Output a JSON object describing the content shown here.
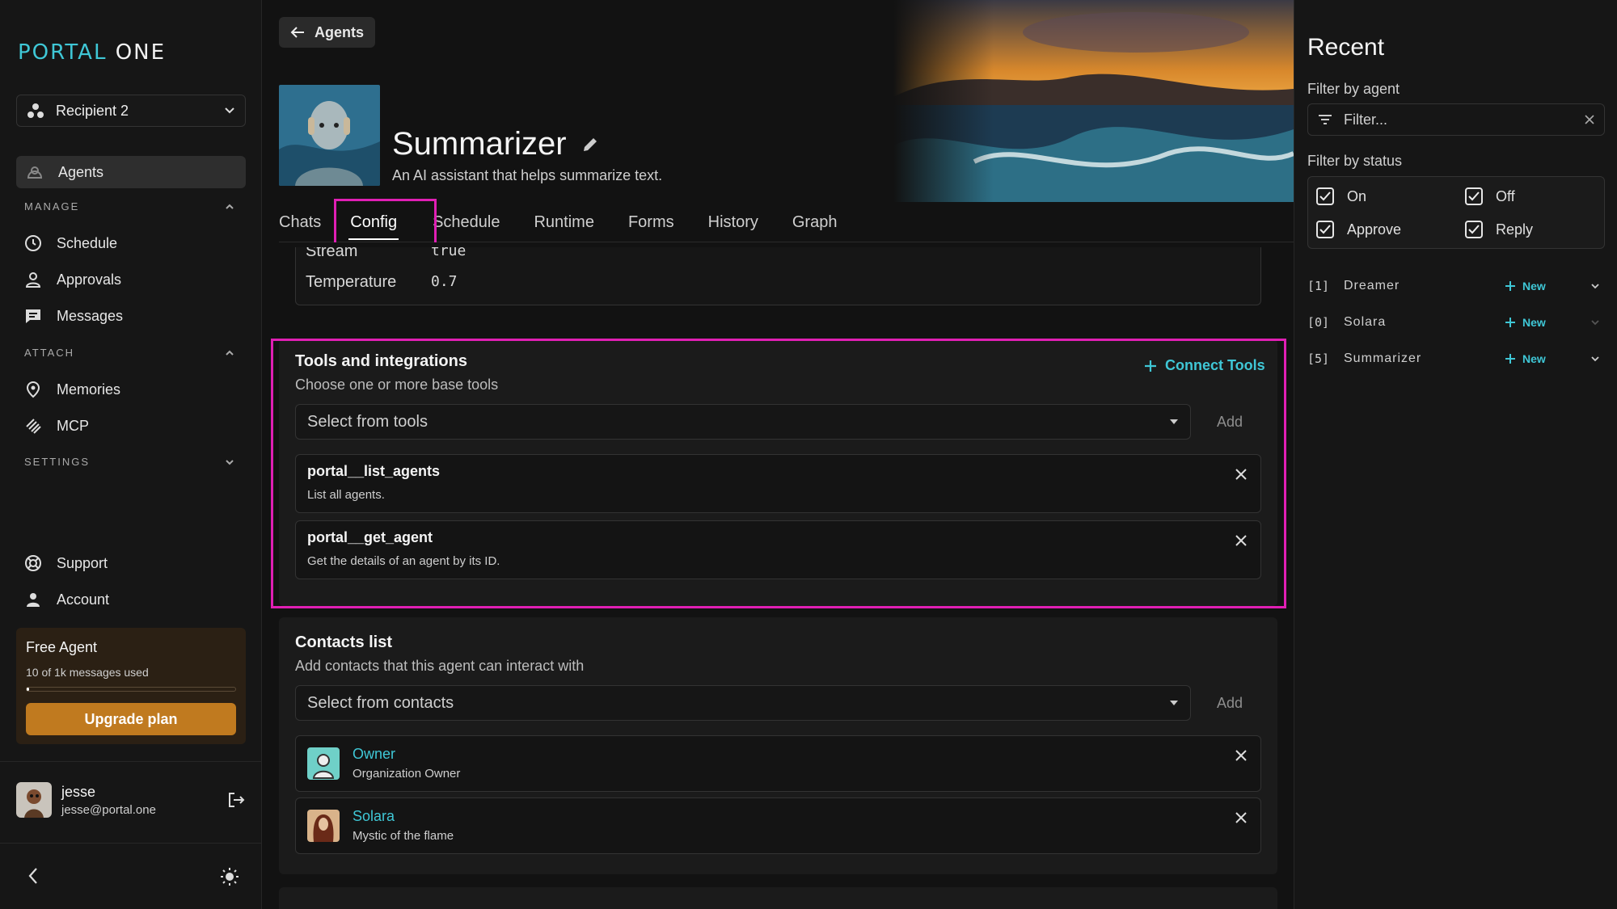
{
  "brand": {
    "part1": "PORTAL",
    "part2": "ONE"
  },
  "sidebar": {
    "recipient": "Recipient 2",
    "active_item": "Agents",
    "manage_header": "MANAGE",
    "manage_items": [
      "Schedule",
      "Approvals",
      "Messages"
    ],
    "attach_header": "ATTACH",
    "attach_items": [
      "Memories",
      "MCP"
    ],
    "settings_header": "SETTINGS",
    "support": "Support",
    "account": "Account",
    "plan": {
      "title": "Free Agent",
      "usage": "10 of 1k messages used",
      "usage_fraction": 0.01,
      "button": "Upgrade plan"
    },
    "user": {
      "name": "jesse",
      "email": "jesse@portal.one"
    }
  },
  "header": {
    "back_label": "Agents",
    "agent_name": "Summarizer",
    "agent_description": "An AI assistant that helps summarize text."
  },
  "tabs": [
    "Chats",
    "Config",
    "Schedule",
    "Runtime",
    "Forms",
    "History",
    "Graph"
  ],
  "active_tab": "Config",
  "params": {
    "stream_label": "Stream",
    "stream_value": "true",
    "temperature_label": "Temperature",
    "temperature_value": "0.7"
  },
  "tools": {
    "title": "Tools and integrations",
    "subtitle": "Choose one or more base tools",
    "connect_label": "Connect Tools",
    "select_placeholder": "Select from tools",
    "add_label": "Add",
    "items": [
      {
        "name": "portal__list_agents",
        "desc": "List all agents."
      },
      {
        "name": "portal__get_agent",
        "desc": "Get the details of an agent by its ID."
      }
    ]
  },
  "contacts": {
    "title": "Contacts list",
    "subtitle": "Add contacts that this agent can interact with",
    "select_placeholder": "Select from contacts",
    "add_label": "Add",
    "items": [
      {
        "name": "Owner",
        "desc": "Organization Owner"
      },
      {
        "name": "Solara",
        "desc": "Mystic of the flame"
      }
    ]
  },
  "recent": {
    "title": "Recent",
    "filter_agent_label": "Filter by agent",
    "filter_placeholder": "Filter...",
    "filter_status_label": "Filter by status",
    "statuses": [
      "On",
      "Off",
      "Approve",
      "Reply"
    ],
    "new_label": "New",
    "rows": [
      {
        "idx": "[1]",
        "name": "Dreamer"
      },
      {
        "idx": "[0]",
        "name": "Solara"
      },
      {
        "idx": "[5]",
        "name": "Summarizer"
      }
    ]
  },
  "colors": {
    "accent": "#3fc7d6",
    "highlight": "#e01fb4",
    "upgrade": "#c07a1f"
  }
}
